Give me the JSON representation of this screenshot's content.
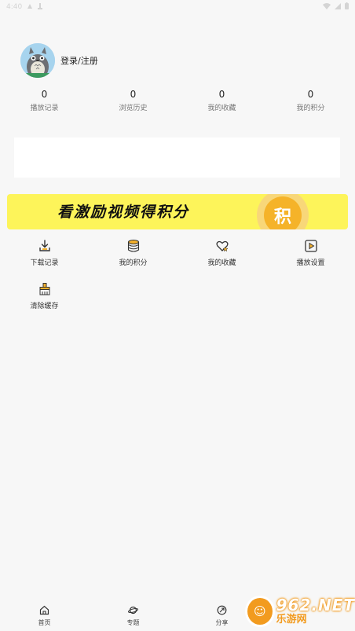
{
  "status_bar": {
    "time": "4:40"
  },
  "profile": {
    "login_label": "登录/注册"
  },
  "stats": [
    {
      "value": "0",
      "label": "播放记录"
    },
    {
      "value": "0",
      "label": "浏览历史"
    },
    {
      "value": "0",
      "label": "我的收藏"
    },
    {
      "value": "0",
      "label": "我的积分"
    }
  ],
  "banner": {
    "text": "看激励视频得积分",
    "coin_char": "积",
    "colors": {
      "background": "#fdf45a",
      "coin": "#f5b329"
    }
  },
  "menu": [
    {
      "label": "下载记录",
      "icon": "download-icon"
    },
    {
      "label": "我的积分",
      "icon": "coins-icon"
    },
    {
      "label": "我的收藏",
      "icon": "heart-star-icon"
    },
    {
      "label": "播放设置",
      "icon": "play-settings-icon"
    },
    {
      "label": "清除缓存",
      "icon": "broom-icon"
    }
  ],
  "bottom_nav": [
    {
      "label": "首页",
      "icon": "home-icon"
    },
    {
      "label": "专题",
      "icon": "planet-icon"
    },
    {
      "label": "分享",
      "icon": "share-icon"
    }
  ],
  "watermark": {
    "brand_top": "962.NET",
    "brand_bottom": "乐游网"
  }
}
